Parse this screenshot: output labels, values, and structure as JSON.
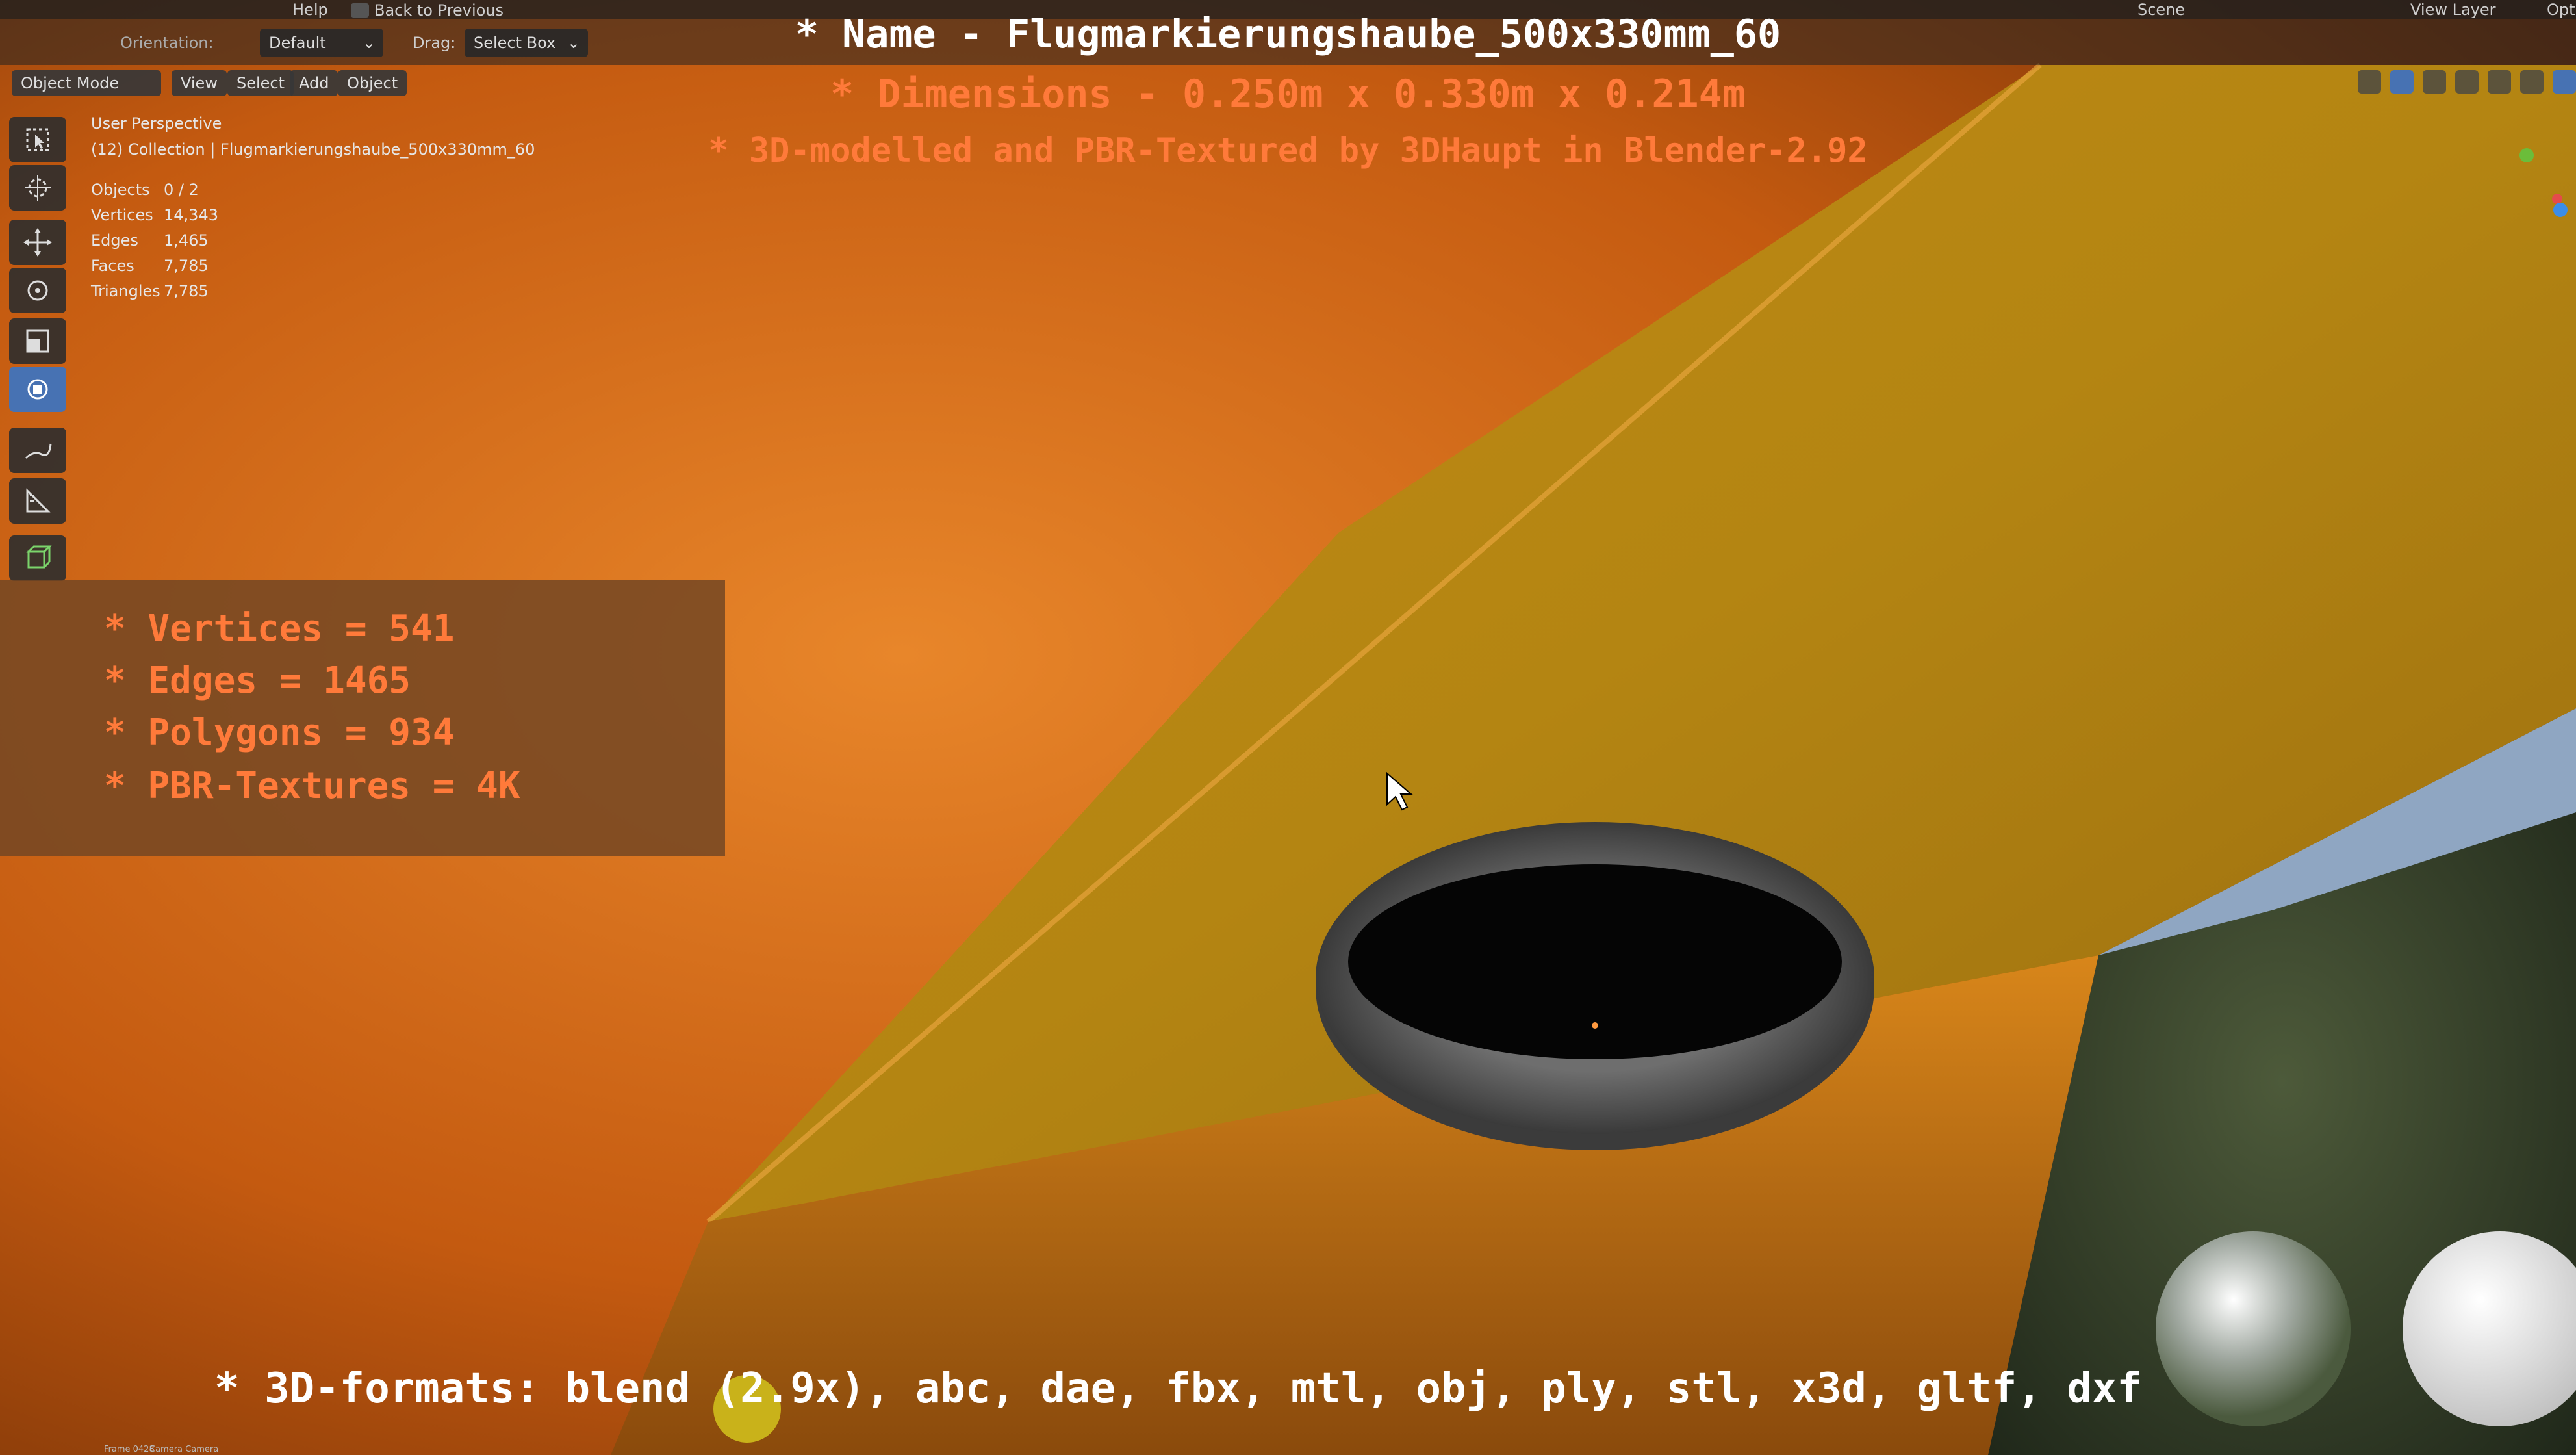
{
  "topbar": {
    "menu_help": "Help",
    "back_to_previous": "Back to Previous",
    "scene_label": "Scene",
    "view_layer_label": "View Layer",
    "options_label": "Opti"
  },
  "header": {
    "orientation_label": "Orientation:",
    "orientation_value": "Default",
    "drag_label": "Drag:",
    "drag_value": "Select Box"
  },
  "modebar": {
    "mode": "Object Mode",
    "menus": [
      "View",
      "Select",
      "Add",
      "Object"
    ]
  },
  "viewport_info": {
    "perspective": "User Perspective",
    "collection": "(12) Collection | Flugmarkierungshaube_500x330mm_60"
  },
  "stats": [
    {
      "label": "Objects",
      "value": "0 / 2"
    },
    {
      "label": "Vertices",
      "value": "14,343"
    },
    {
      "label": "Edges",
      "value": "1,465"
    },
    {
      "label": "Faces",
      "value": "7,785"
    },
    {
      "label": "Triangles",
      "value": "7,785"
    }
  ],
  "title_lines": {
    "name": "* Name - Flugmarkierungshaube_500x330mm_60",
    "dimensions": "* Dimensions -  0.250m x 0.330m x 0.214m",
    "credit": "* 3D-modelled and PBR-Textured by 3DHaupt in Blender-2.92"
  },
  "info_box": [
    "* Vertices = 541",
    "* Edges = 1465",
    "* Polygons = 934",
    "* PBR-Textures = 4K"
  ],
  "formats": "* 3D-formats: blend (2.9x), abc, dae, fbx, mtl, obj, ply, stl, x3d, gltf, dxf",
  "statusbar": {
    "frame": "Frame 0428",
    "camera": "Camera Camera"
  },
  "colors": {
    "orange_text": "#ff7a3a",
    "white_text": "#ffffff",
    "active_tool": "#4772b3"
  },
  "icons": [
    "select-box-icon",
    "cursor-icon",
    "move-icon",
    "rotate-icon",
    "scale-icon",
    "transform-icon",
    "annotate-icon",
    "measure-icon",
    "add-cube-icon"
  ]
}
